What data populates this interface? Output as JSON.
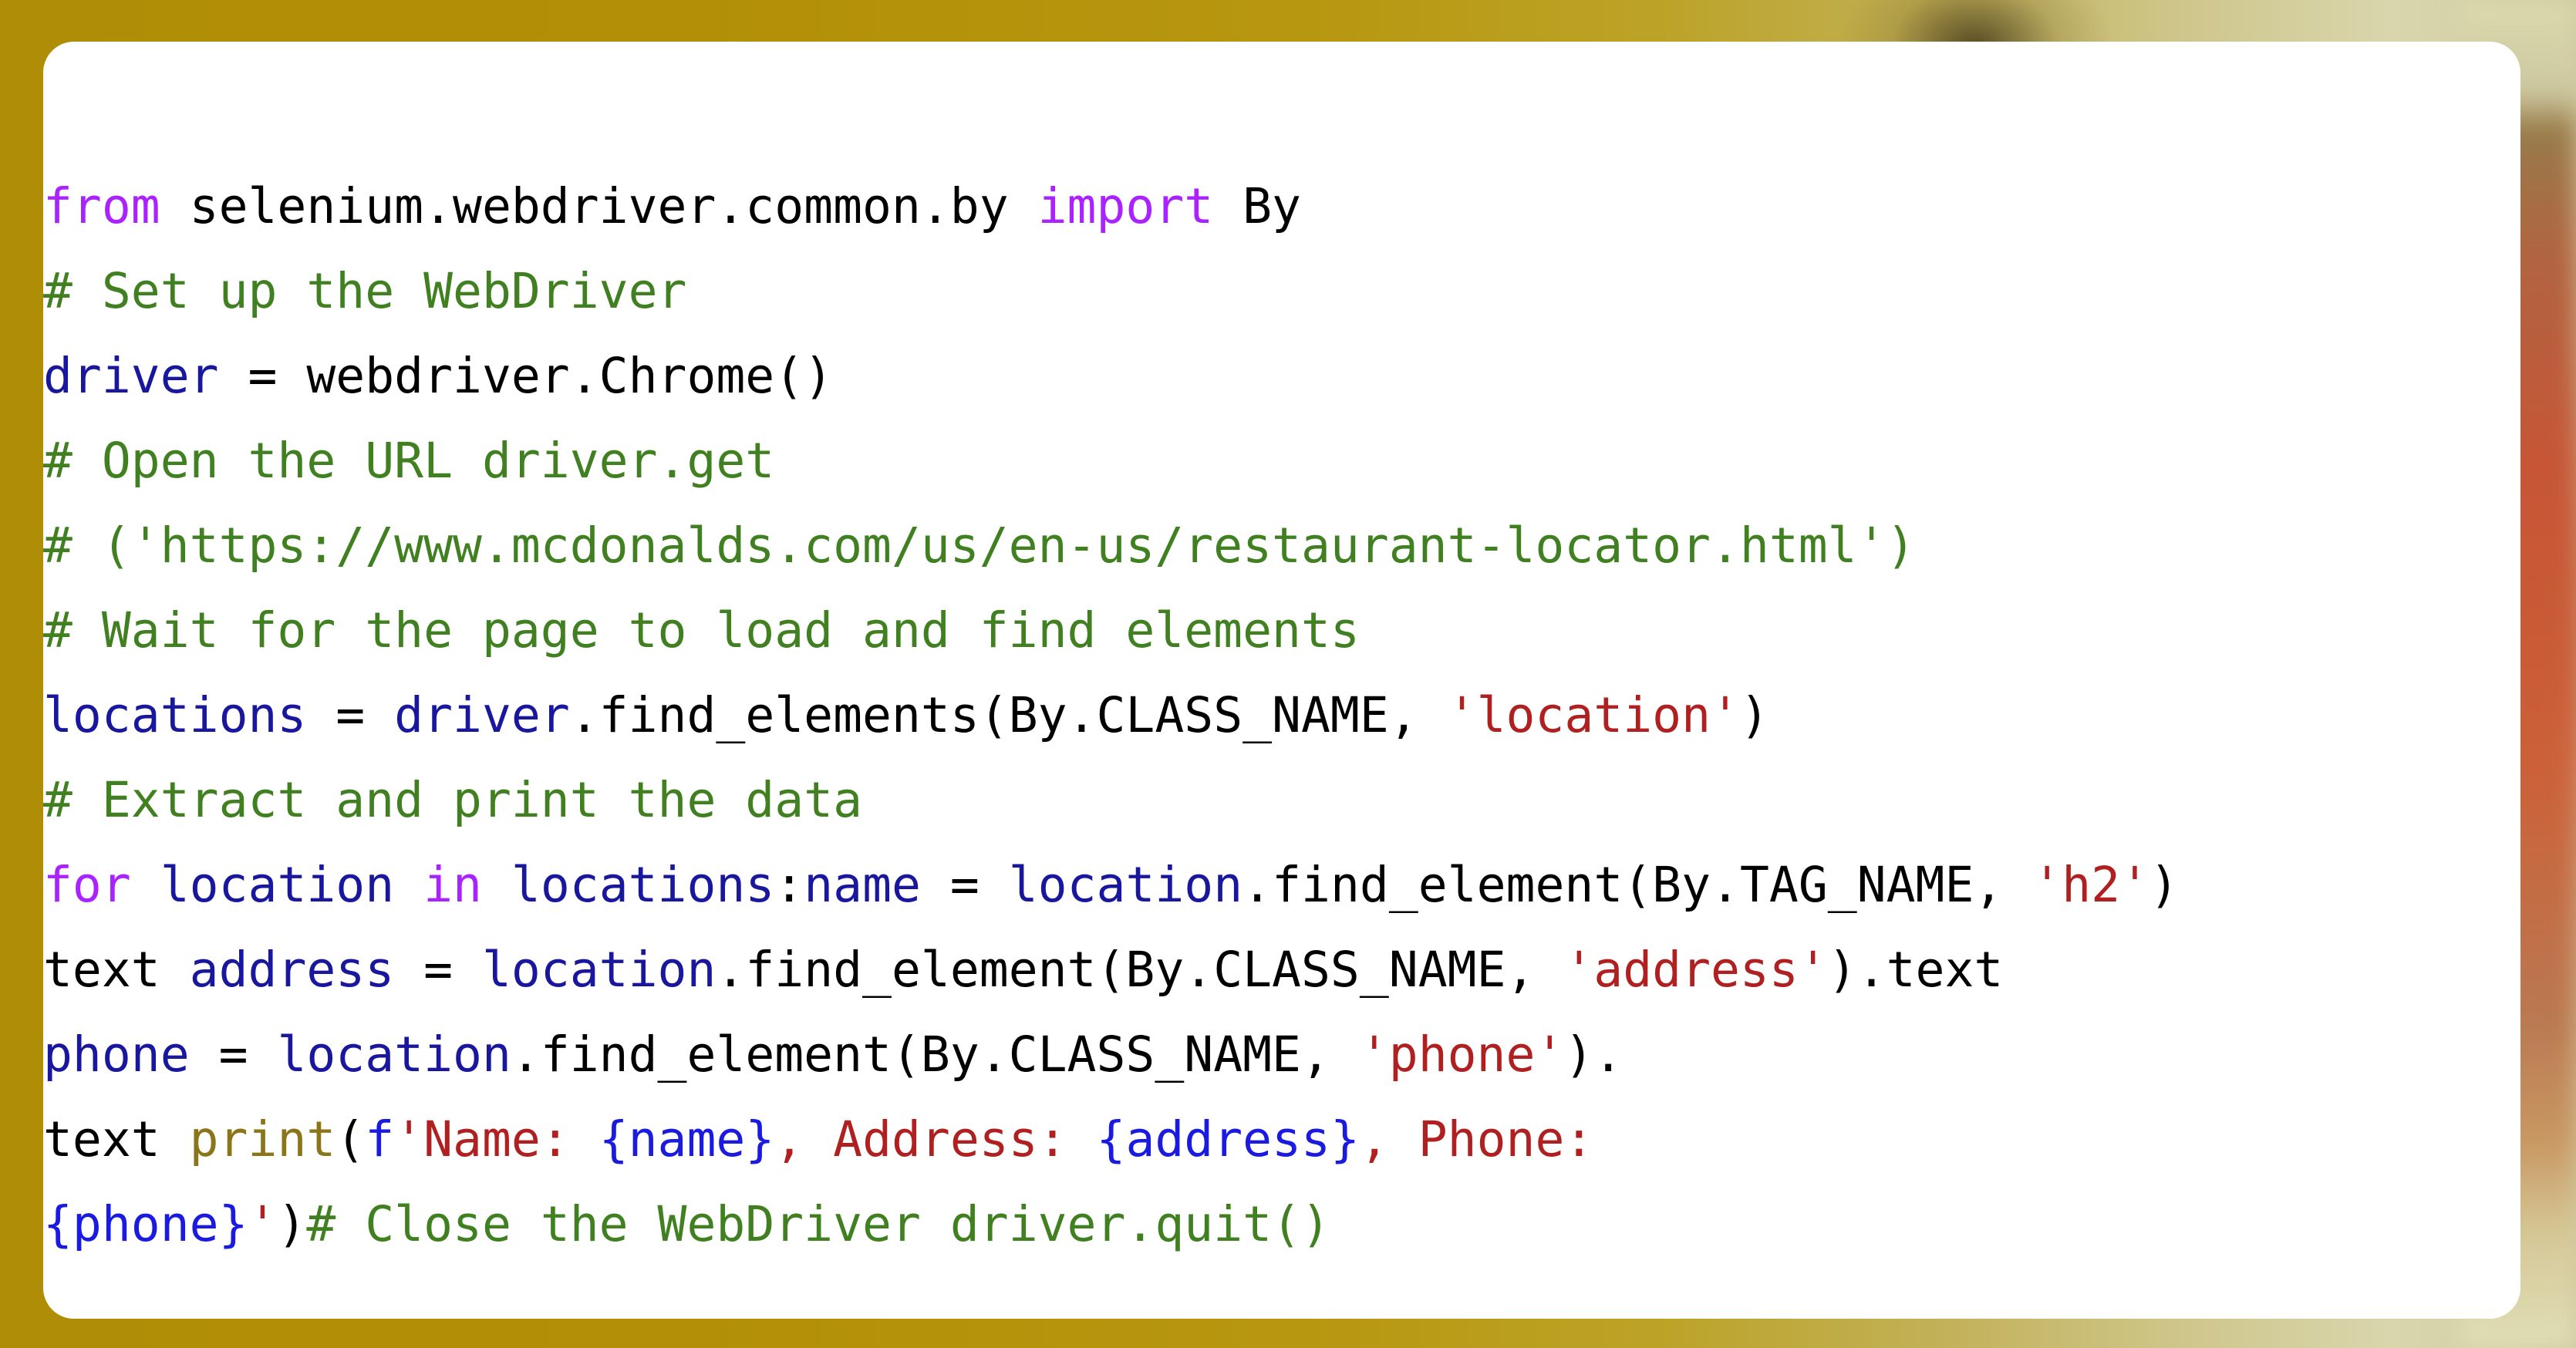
{
  "background": {
    "accent_gold": "#b08d06",
    "accent_light": "#d9d6ad",
    "accent_red": "#c44a30"
  },
  "card": {
    "background_color": "#ffffff",
    "corner_radius_px": 40
  },
  "syntax_colors": {
    "plain": "#000000",
    "keyword": "#aa22ff",
    "comment": "#408020",
    "string": "#b02020",
    "variable": "#19179e",
    "function": "#8a7518",
    "brace": "#1a1ae0"
  },
  "code": {
    "language": "python",
    "plain_text": "from selenium.webdriver.common.by import By\n# Set up the WebDriver\ndriver = webdriver.Chrome()\n# Open the URL driver.get\n# ('https://www.mcdonalds.com/us/en-us/restaurant-locator.html')\n# Wait for the page to load and find elements\nlocations = driver.find_elements(By.CLASS_NAME, 'location')\n# Extract and print the data\nfor location in locations:name = location.find_element(By.TAG_NAME, 'h2')\ntext address = location.find_element(By.CLASS_NAME, 'address').text\nphone = location.find_element(By.CLASS_NAME, 'phone').\ntext print(f'Name: {name}, Address: {address}, Phone:\n{phone}')# Close the WebDriver driver.quit()",
    "lines": [
      [
        {
          "t": "from",
          "c": "keyword"
        },
        {
          "t": " selenium.webdriver.common.by ",
          "c": "plain"
        },
        {
          "t": "import",
          "c": "keyword"
        },
        {
          "t": " By",
          "c": "plain"
        }
      ],
      [
        {
          "t": "# Set up the WebDriver",
          "c": "comment"
        }
      ],
      [
        {
          "t": "driver",
          "c": "variable"
        },
        {
          "t": " = webdriver.Chrome()",
          "c": "plain"
        }
      ],
      [
        {
          "t": "# Open the URL driver.get",
          "c": "comment"
        }
      ],
      [
        {
          "t": "# ('https://www.mcdonalds.com/us/en-us/restaurant-locator.html')",
          "c": "comment"
        }
      ],
      [
        {
          "t": "# Wait for the page to load and find elements",
          "c": "comment"
        }
      ],
      [
        {
          "t": "locations",
          "c": "variable"
        },
        {
          "t": " = ",
          "c": "plain"
        },
        {
          "t": "driver",
          "c": "variable"
        },
        {
          "t": ".find_elements(By.CLASS_NAME, ",
          "c": "plain"
        },
        {
          "t": "'location'",
          "c": "string"
        },
        {
          "t": ")",
          "c": "plain"
        }
      ],
      [
        {
          "t": "# Extract and print the data",
          "c": "comment"
        }
      ],
      [
        {
          "t": "for",
          "c": "keyword"
        },
        {
          "t": " ",
          "c": "plain"
        },
        {
          "t": "location",
          "c": "variable"
        },
        {
          "t": " ",
          "c": "plain"
        },
        {
          "t": "in",
          "c": "keyword"
        },
        {
          "t": " ",
          "c": "plain"
        },
        {
          "t": "locations",
          "c": "variable"
        },
        {
          "t": ":",
          "c": "plain"
        },
        {
          "t": "name",
          "c": "variable"
        },
        {
          "t": " = ",
          "c": "plain"
        },
        {
          "t": "location",
          "c": "variable"
        },
        {
          "t": ".find_element(By.TAG_NAME, ",
          "c": "plain"
        },
        {
          "t": "'h2'",
          "c": "string"
        },
        {
          "t": ")",
          "c": "plain"
        }
      ],
      [
        {
          "t": "text ",
          "c": "plain"
        },
        {
          "t": "address",
          "c": "variable"
        },
        {
          "t": " = ",
          "c": "plain"
        },
        {
          "t": "location",
          "c": "variable"
        },
        {
          "t": ".find_element(By.CLASS_NAME, ",
          "c": "plain"
        },
        {
          "t": "'address'",
          "c": "string"
        },
        {
          "t": ").text",
          "c": "plain"
        }
      ],
      [
        {
          "t": "phone",
          "c": "variable"
        },
        {
          "t": " = ",
          "c": "plain"
        },
        {
          "t": "location",
          "c": "variable"
        },
        {
          "t": ".find_element(By.CLASS_NAME, ",
          "c": "plain"
        },
        {
          "t": "'phone'",
          "c": "string"
        },
        {
          "t": ").",
          "c": "plain"
        }
      ],
      [
        {
          "t": "text ",
          "c": "plain"
        },
        {
          "t": "print",
          "c": "function"
        },
        {
          "t": "(",
          "c": "plain"
        },
        {
          "t": "f",
          "c": "brace"
        },
        {
          "t": "'Name: ",
          "c": "string"
        },
        {
          "t": "{name}",
          "c": "brace"
        },
        {
          "t": ", Address: ",
          "c": "string"
        },
        {
          "t": "{address}",
          "c": "brace"
        },
        {
          "t": ", Phone:",
          "c": "string"
        }
      ],
      [
        {
          "t": "{phone}",
          "c": "brace"
        },
        {
          "t": "'",
          "c": "string"
        },
        {
          "t": ")",
          "c": "plain"
        },
        {
          "t": "# Close the WebDriver driver.quit()",
          "c": "comment"
        }
      ]
    ]
  }
}
